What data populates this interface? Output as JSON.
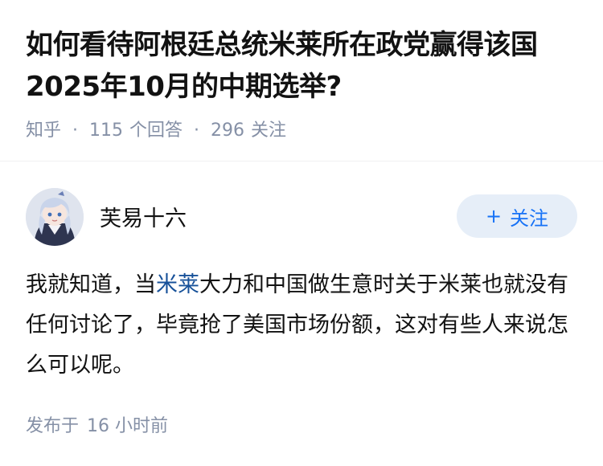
{
  "question": {
    "title": "如何看待阿根廷总统米莱所在政党赢得该国2025年10月的中期选举?",
    "source": "知乎",
    "answers_count": "115",
    "answers_label": "个回答",
    "followers_count": "296",
    "followers_label": "关注"
  },
  "answer": {
    "author_name": "芙易十六",
    "follow_button": "关注",
    "follow_icon": "plus-icon",
    "content_before": "我就知道，当",
    "content_link": "米莱",
    "content_after": "大力和中国做生意时关于米莱也就没有任何讨论了，毕竟抢了美国市场份额，这对有些人来说怎么可以呢。",
    "published_label": "发布于",
    "published_time": "16 小时前"
  },
  "colors": {
    "meta_gray": "#8590a6",
    "link_blue": "#175199",
    "accent_blue": "#1772f6",
    "button_bg": "#e6eef8"
  }
}
